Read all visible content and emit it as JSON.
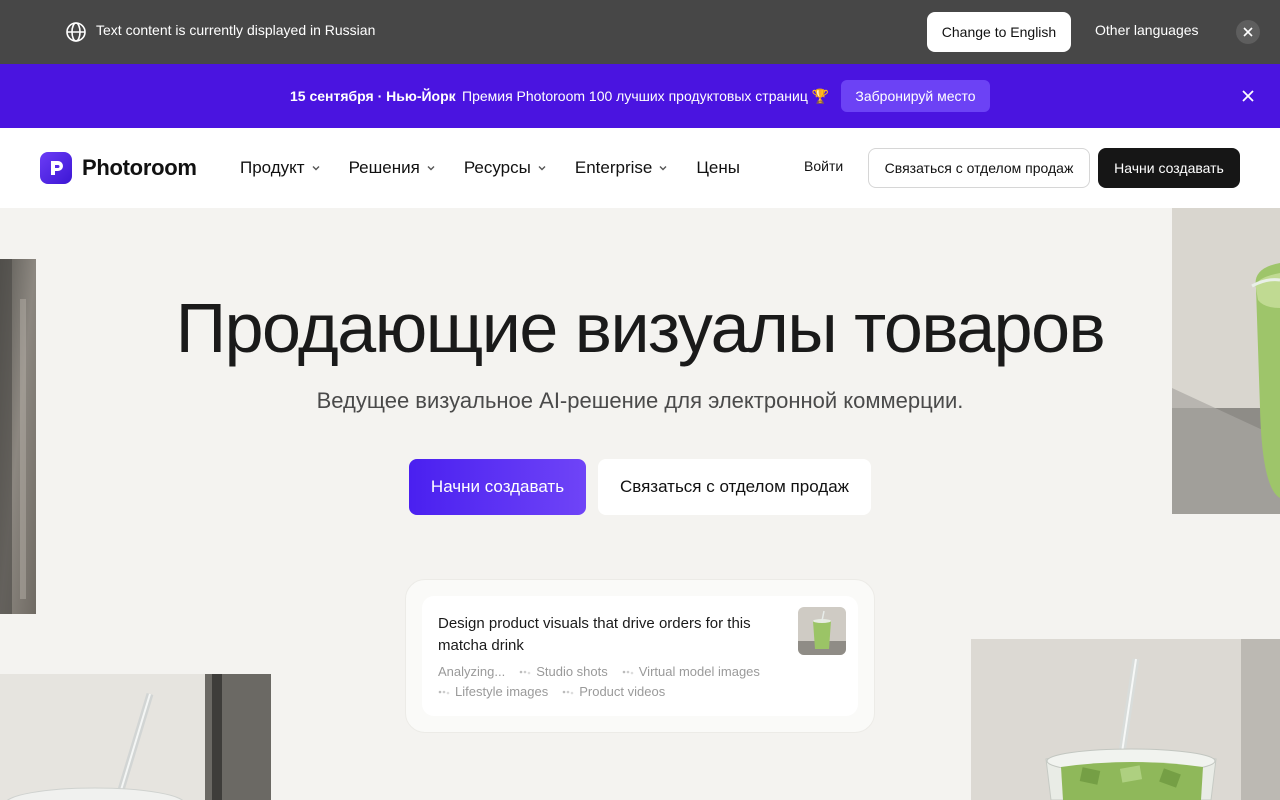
{
  "language_bar": {
    "message": "Text content is currently displayed in Russian",
    "change_label": "Change to English",
    "other_label": "Other languages",
    "globe_icon": "globe-icon",
    "close_icon": "close-icon"
  },
  "promo": {
    "date": "15 сентября · Нью-Йорк",
    "text": "Премия Photoroom 100 лучших продуктовых страниц 🏆",
    "cta": "Забронируй место",
    "close_icon": "close-icon"
  },
  "header": {
    "logo_text": "Photoroom",
    "nav": [
      {
        "label": "Продукт",
        "has_dropdown": true
      },
      {
        "label": "Решения",
        "has_dropdown": true
      },
      {
        "label": "Ресурсы",
        "has_dropdown": true
      },
      {
        "label": "Enterprise",
        "has_dropdown": true
      },
      {
        "label": "Цены",
        "has_dropdown": false
      }
    ],
    "login": "Войти",
    "contact": "Связаться с отделом продаж",
    "start": "Начни создавать"
  },
  "hero": {
    "title": "Продающие визуалы товаров",
    "subtitle": "Ведущее визуальное AI-решение для электронной коммерции.",
    "start": "Начни создавать",
    "contact": "Связаться с отделом продаж"
  },
  "prompt_card": {
    "prompt": "Design product visuals that drive orders for this matcha drink",
    "chips_row1": [
      "Analyzing...",
      "Studio shots",
      "Virtual model images"
    ],
    "chips_row2": [
      "Lifestyle images",
      "Product videos"
    ]
  },
  "colors": {
    "lang_bar_bg": "#474747",
    "promo_bg": "#4a14e0",
    "accent": "#5a2ff2",
    "page_bg": "#f4f3f0",
    "matcha": "#8fb85a"
  }
}
